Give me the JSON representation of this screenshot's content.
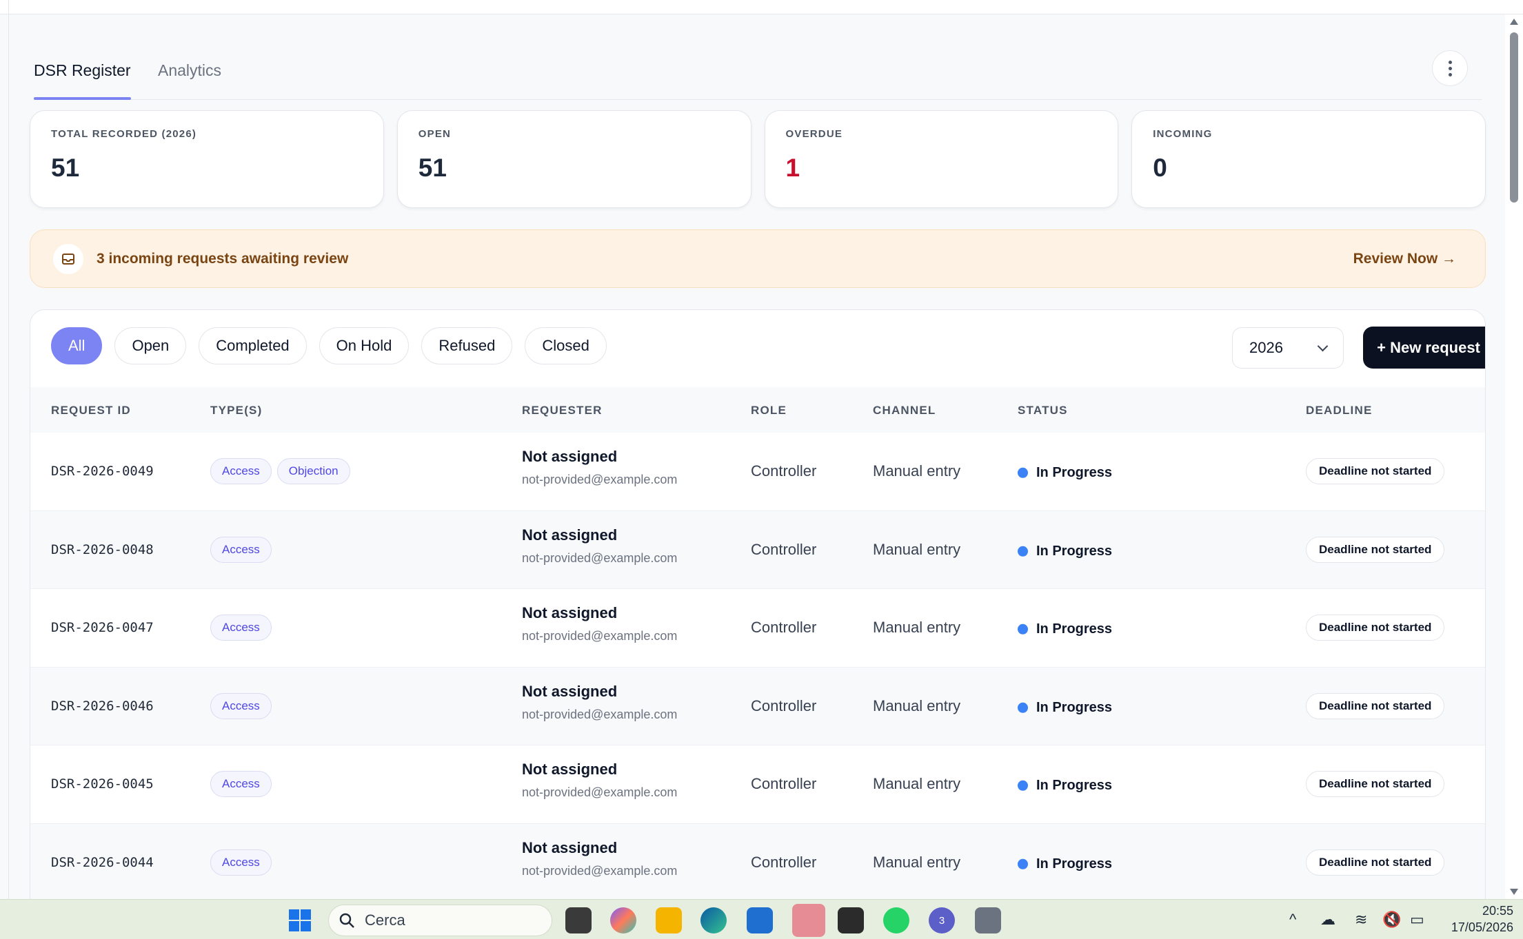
{
  "tabs": {
    "register": "DSR Register",
    "analytics": "Analytics"
  },
  "stats": [
    {
      "label": "TOTAL RECORDED (2026)",
      "value": "51"
    },
    {
      "label": "OPEN",
      "value": "51"
    },
    {
      "label": "OVERDUE",
      "value": "1"
    },
    {
      "label": "INCOMING",
      "value": "0"
    }
  ],
  "banner": {
    "text": "3 incoming requests awaiting review",
    "link": "Review Now →",
    "icon": "inbox-icon"
  },
  "filters": [
    "All",
    "Open",
    "Completed",
    "On Hold",
    "Refused",
    "Closed"
  ],
  "year": "2026",
  "new_request": "+ New request",
  "columns": [
    "REQUEST ID",
    "TYPE(S)",
    "REQUESTER",
    "ROLE",
    "CHANNEL",
    "STATUS",
    "DEADLINE"
  ],
  "rows": [
    {
      "id": "DSR-2026-0049",
      "types": [
        "Access",
        "Objection"
      ],
      "requester": "Not assigned",
      "email": "not-provided@example.com",
      "role": "Controller",
      "channel": "Manual entry",
      "status": "In Progress",
      "deadline": "Deadline not started"
    },
    {
      "id": "DSR-2026-0048",
      "types": [
        "Access"
      ],
      "requester": "Not assigned",
      "email": "not-provided@example.com",
      "role": "Controller",
      "channel": "Manual entry",
      "status": "In Progress",
      "deadline": "Deadline not started"
    },
    {
      "id": "DSR-2026-0047",
      "types": [
        "Access"
      ],
      "requester": "Not assigned",
      "email": "not-provided@example.com",
      "role": "Controller",
      "channel": "Manual entry",
      "status": "In Progress",
      "deadline": "Deadline not started"
    },
    {
      "id": "DSR-2026-0046",
      "types": [
        "Access"
      ],
      "requester": "Not assigned",
      "email": "not-provided@example.com",
      "role": "Controller",
      "channel": "Manual entry",
      "status": "In Progress",
      "deadline": "Deadline not started"
    },
    {
      "id": "DSR-2026-0045",
      "types": [
        "Access"
      ],
      "requester": "Not assigned",
      "email": "not-provided@example.com",
      "role": "Controller",
      "channel": "Manual entry",
      "status": "In Progress",
      "deadline": "Deadline not started"
    },
    {
      "id": "DSR-2026-0044",
      "types": [
        "Access"
      ],
      "requester": "Not assigned",
      "email": "not-provided@example.com",
      "role": "Controller",
      "channel": "Manual entry",
      "status": "In Progress",
      "deadline": "Deadline not started"
    }
  ],
  "taskbar": {
    "search_placeholder": "Cerca",
    "teams_badge": "3",
    "time": "20:55",
    "date": "17/05/2026"
  },
  "colors": {
    "accent": "#7c83f2",
    "overdue": "#c8102e",
    "status_in_progress": "#3b82f6",
    "banner_bg": "#fdf2e4",
    "primary_button": "#0b1120"
  }
}
